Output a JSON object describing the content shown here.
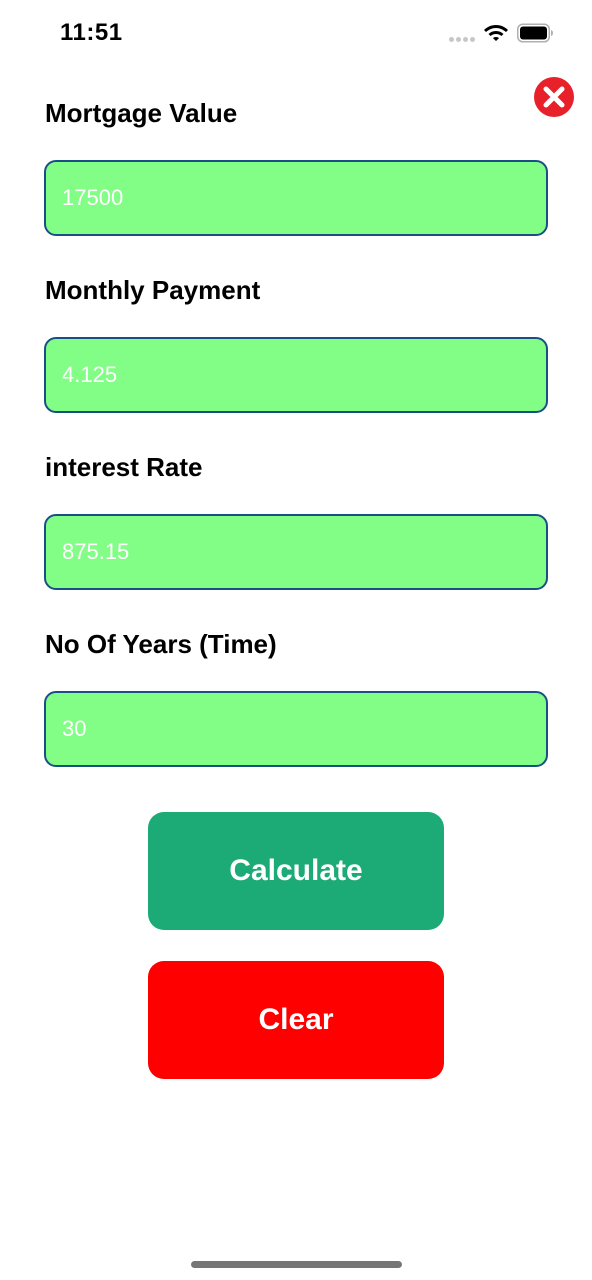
{
  "status_bar": {
    "time": "11:51"
  },
  "icons": {
    "signal": "cellular-signal-icon",
    "wifi": "wifi-icon",
    "battery": "battery-icon",
    "close": "close-circle-icon"
  },
  "form": {
    "mortgage_value": {
      "label": "Mortgage Value",
      "value": "17500"
    },
    "monthly_payment": {
      "label": "Monthly Payment",
      "value": "4.125"
    },
    "interest_rate": {
      "label": "interest Rate",
      "value": "875.15"
    },
    "years": {
      "label": "No Of Years (Time)",
      "value": "30"
    }
  },
  "buttons": {
    "calculate": "Calculate",
    "clear": "Clear"
  },
  "colors": {
    "field_background": "#82fe86",
    "field_border": "#1a4f86",
    "calculate_button": "#1cab76",
    "clear_button": "#fe0000",
    "close_icon": "#e8202a"
  }
}
